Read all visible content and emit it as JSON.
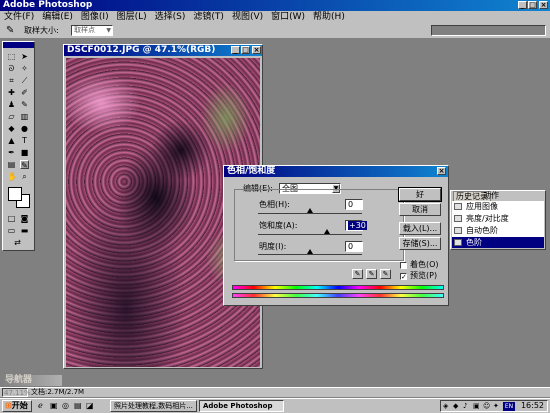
{
  "app": {
    "title": "Adobe Photoshop"
  },
  "menu": [
    "文件(F)",
    "编辑(E)",
    "图像(I)",
    "图层(L)",
    "选择(S)",
    "滤镜(T)",
    "视图(V)",
    "窗口(W)",
    "帮助(H)"
  ],
  "options_bar": {
    "label": "取样大小:",
    "value": "取样点"
  },
  "document": {
    "title": "DSCF0012.JPG @ 47.1%(RGB)"
  },
  "dialog": {
    "title": "色相/饱和度",
    "edit_label": "编辑(E):",
    "edit_value": "全图",
    "hue_label": "色相(H):",
    "hue_value": "0",
    "sat_label": "饱和度(A):",
    "sat_value": "+30",
    "light_label": "明度(I):",
    "light_value": "0",
    "ok": "好",
    "cancel": "取消",
    "load": "载入(L)...",
    "save": "存储(S)...",
    "colorize": "着色(O)",
    "preview": "预览(P)",
    "hue_level": 0,
    "sat_level": 30,
    "light_level": 0
  },
  "history": {
    "tabs": [
      "历史记录",
      "动作"
    ],
    "items": [
      "应用图像",
      "亮度/对比度",
      "自动色阶",
      "色阶"
    ],
    "selected_index": 3
  },
  "navigator": {
    "title": "导航器"
  },
  "status": {
    "zoom": "47.11%",
    "info": "文档:2.7M/2.7M"
  },
  "taskbar": {
    "start": "开始",
    "tasks": [
      "照片处理教程,数码相片...",
      "Adobe Photoshop"
    ],
    "clock": "16:52",
    "tray_badge": "EN"
  },
  "colors": {
    "title_active": "#000080",
    "selection": "#000080",
    "desktop": "#808080"
  }
}
